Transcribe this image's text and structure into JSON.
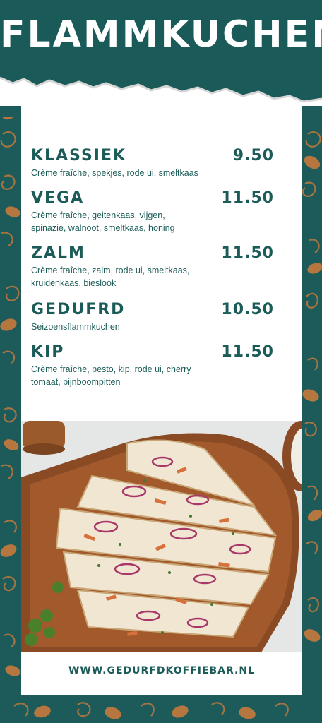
{
  "header": {
    "title": "FLAMMKUCHEN"
  },
  "menu": [
    {
      "name": "KLASSIEK",
      "price": "9.50",
      "desc": "Crème fraîche, spekjes, rode ui, smeltkaas"
    },
    {
      "name": "VEGA",
      "price": "11.50",
      "desc": "Crème fraîche, geitenkaas, vijgen, spinazie, walnoot, smeltkaas, honing"
    },
    {
      "name": "ZALM",
      "price": "11.50",
      "desc": "Crème fraîche, zalm, rode ui, smeltkaas, kruidenkaas, bieslook"
    },
    {
      "name": "GEDUFRD",
      "price": "10.50",
      "desc": "Seizoensflammkuchen"
    },
    {
      "name": "KIP",
      "price": "11.50",
      "desc": "Crème fraîche, pesto, kip, rode ui, cherry tomaat, pijnboompitten"
    }
  ],
  "footer": {
    "url": "WWW.GEDURFDKOFFIEBAR.NL"
  },
  "colors": {
    "brand": "#1a5a58",
    "accent": "#b5773f",
    "card": "#ffffff"
  }
}
